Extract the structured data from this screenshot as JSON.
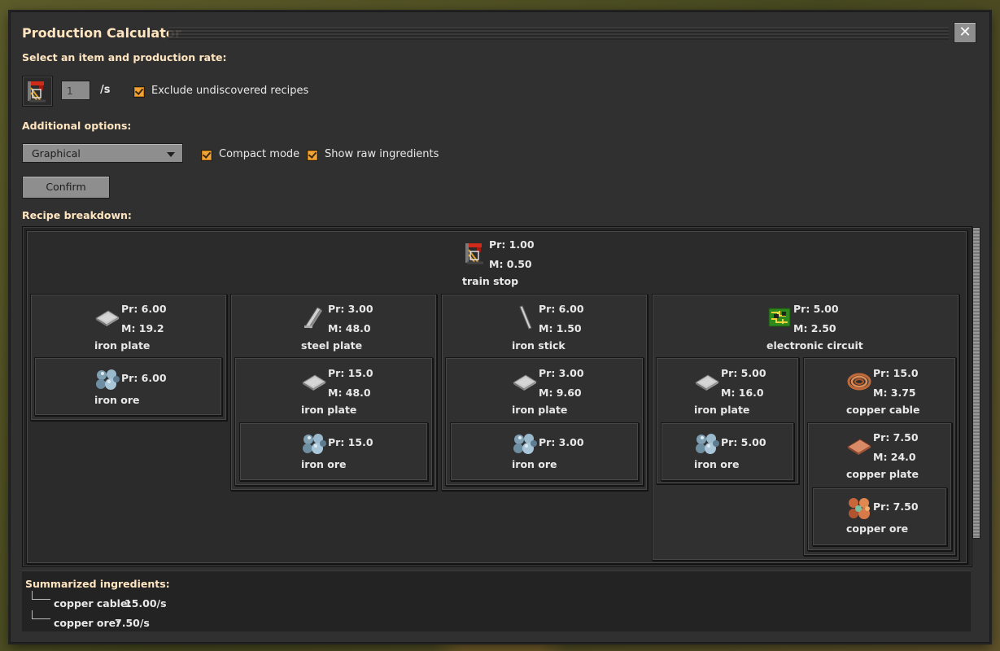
{
  "window": {
    "title": "Production Calculator",
    "close_glyph": "✕"
  },
  "select": {
    "heading": "Select an item and production rate:",
    "item_icon": "train-stop-icon",
    "rate_value": "1",
    "rate_unit": "/s",
    "exclude_label": "Exclude undiscovered recipes",
    "exclude_checked": true
  },
  "options": {
    "heading": "Additional options:",
    "mode_selected": "Graphical",
    "compact_label": "Compact mode",
    "compact_checked": true,
    "raw_label": "Show raw ingredients",
    "raw_checked": true
  },
  "confirm_label": "Confirm",
  "breakdown": {
    "heading": "Recipe breakdown:",
    "root": {
      "name": "train stop",
      "pr": "Pr: 1.00",
      "m": "M: 0.50"
    },
    "ingredients": [
      {
        "name": "iron plate",
        "pr": "Pr: 6.00",
        "m": "M: 19.2",
        "children": [
          {
            "name": "iron ore",
            "pr": "Pr: 6.00"
          }
        ]
      },
      {
        "name": "steel plate",
        "pr": "Pr: 3.00",
        "m": "M: 48.0",
        "children": [
          {
            "name": "iron plate",
            "pr": "Pr: 15.0",
            "m": "M: 48.0"
          },
          {
            "name": "iron ore",
            "pr": "Pr: 15.0"
          }
        ]
      },
      {
        "name": "iron stick",
        "pr": "Pr: 6.00",
        "m": "M: 1.50",
        "children": [
          {
            "name": "iron plate",
            "pr": "Pr: 3.00",
            "m": "M: 9.60"
          },
          {
            "name": "iron ore",
            "pr": "Pr: 3.00"
          }
        ]
      },
      {
        "name": "electronic circuit",
        "pr": "Pr: 5.00",
        "m": "M: 2.50",
        "children": [
          {
            "name": "iron plate",
            "pr": "Pr: 5.00",
            "m": "M: 16.0",
            "children": [
              {
                "name": "iron ore",
                "pr": "Pr: 5.00"
              }
            ]
          },
          {
            "name": "copper cable",
            "pr": "Pr: 15.0",
            "m": "M: 3.75",
            "children": [
              {
                "name": "copper plate",
                "pr": "Pr: 7.50",
                "m": "M: 24.0",
                "children": [
                  {
                    "name": "copper ore",
                    "pr": "Pr: 7.50"
                  }
                ]
              }
            ]
          }
        ]
      }
    ]
  },
  "summary": {
    "heading": "Summarized ingredients:",
    "items": [
      {
        "name": "copper cable:",
        "rate": "15.00/s"
      },
      {
        "name": "copper ore:",
        "rate": "7.50/s"
      }
    ]
  },
  "colors": {
    "accent_checkbox": "#f1a33a",
    "title_text": "#ffe6c0",
    "panel_bg": "#313031"
  }
}
